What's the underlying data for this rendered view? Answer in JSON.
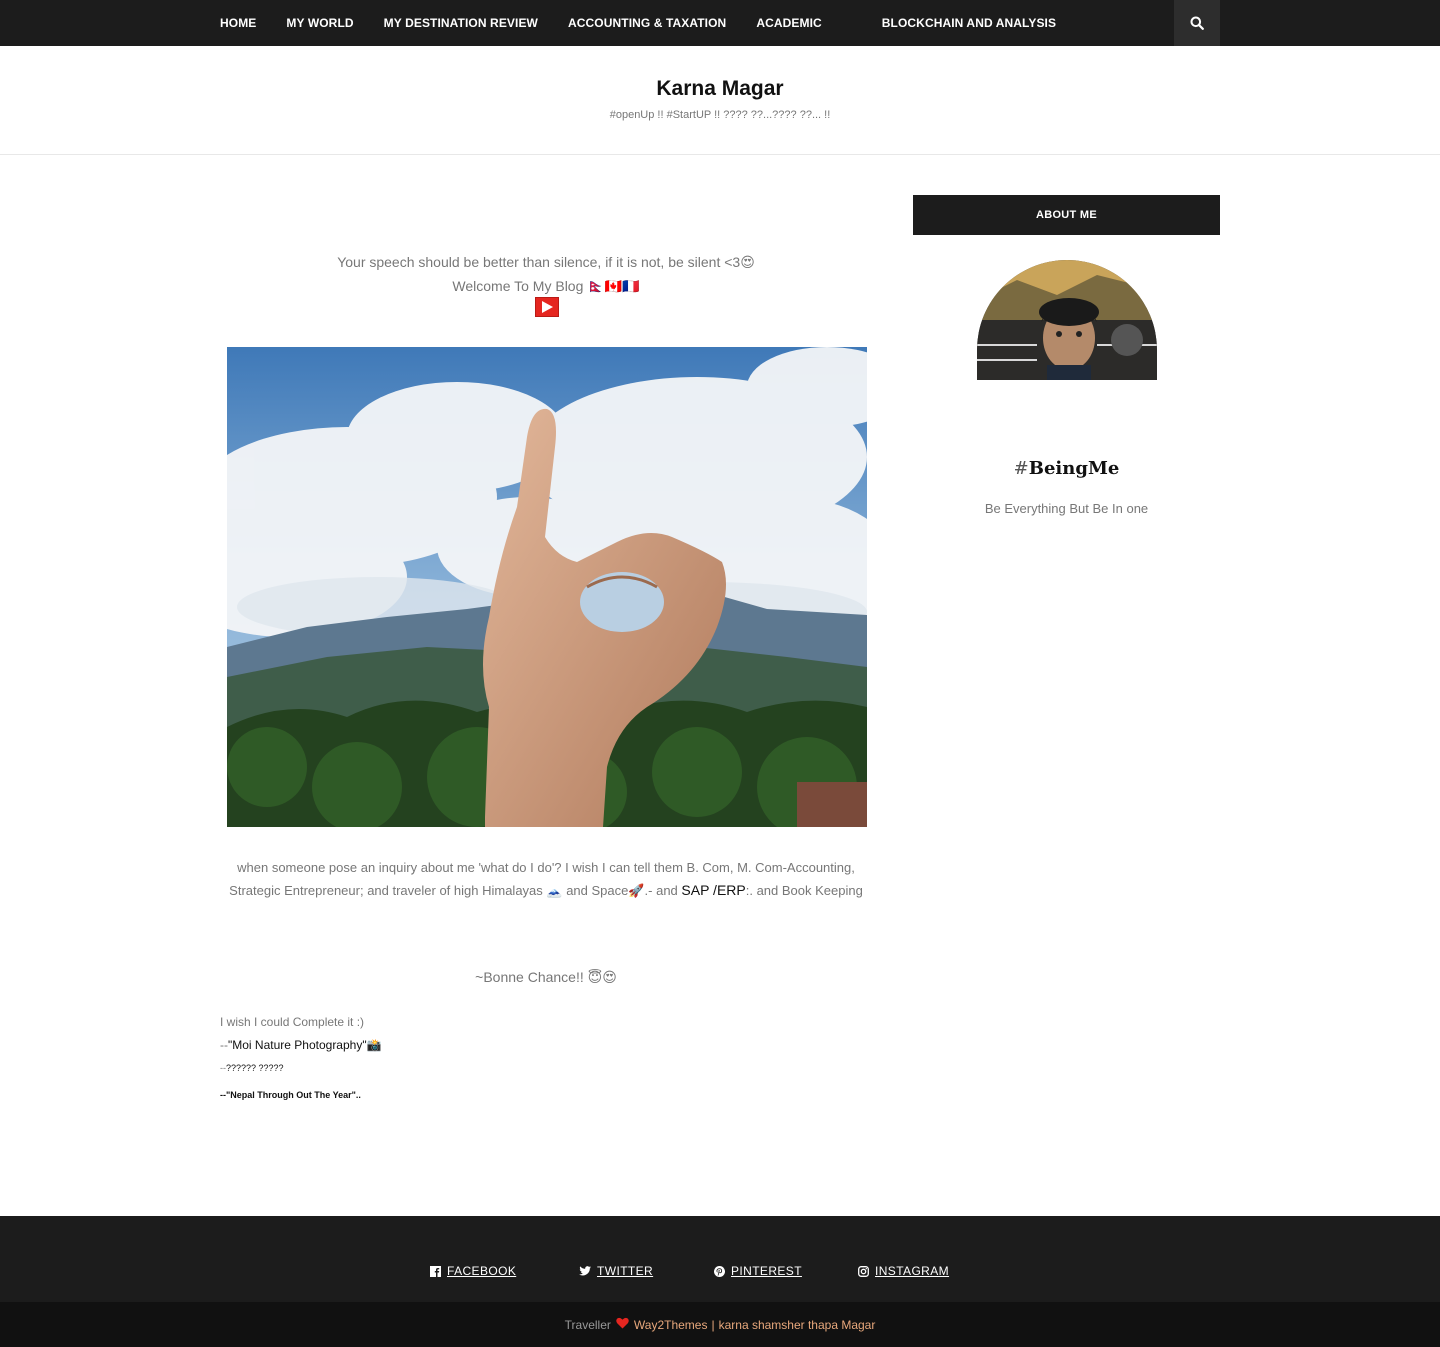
{
  "nav": {
    "items": [
      "HOME",
      "MY WORLD",
      "MY DESTINATION REVIEW",
      "ACCOUNTING & TAXATION",
      "ACADEMIC",
      "BLOCKCHAIN AND ANALYSIS"
    ]
  },
  "header": {
    "title": "Karna Magar",
    "tagline": "#openUp !! #StartUP !! ???? ??...???? ??... !!"
  },
  "main": {
    "quote": "Your speech should be better than silence, if it is not, be silent  <3😍",
    "welcome": "Welcome To My Blog  🇳🇵🇨🇦🇫🇷",
    "intro_line1": "when someone pose an inquiry about me 'what do I do'? I wish I can tell them B. Com, M. Com-Accounting,",
    "intro_line2_a": "Strategic Entrepreneur; and traveler of high Himalayas 🗻 and Space🚀.-  and ",
    "intro_link": "SAP /ERP",
    "intro_line2_b": ":. and Book Keeping",
    "bonne": "~Bonne Chance!! 😇😍",
    "complete": "I wish I could Complete it :)",
    "moi_prefix": "--",
    "moi_link": "\"Moi Nature Photography\"",
    "moi_suffix": "📸",
    "nepali_prefix": "--",
    "nepali_text": "?????? ?????",
    "nepal_year": "--\"Nepal Through Out The Year\".."
  },
  "sidebar": {
    "widget_title": "ABOUT ME",
    "hash": "#",
    "heading": "BeingMe",
    "subtitle": "Be Everything But Be In one"
  },
  "footer": {
    "social": [
      "FACEBOOK",
      "TWITTER",
      "PINTEREST",
      "INSTAGRAM"
    ],
    "theme_name": "Traveller",
    "credit_link": "Way2Themes",
    "separator": "|",
    "author_link": "karna shamsher thapa Magar"
  },
  "colors": {
    "dark": "#1c1c1c",
    "accent_link": "#e8a87c",
    "heart": "#e52620"
  }
}
